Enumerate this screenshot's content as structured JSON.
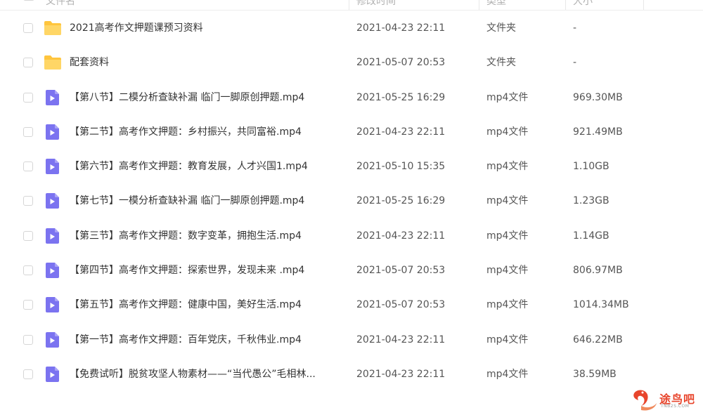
{
  "header": {
    "col_name": "文件名",
    "col_modified": "修改时间",
    "col_type": "类型",
    "col_size": "大小"
  },
  "colors": {
    "folder": "#FFC53D",
    "video": "#7B73F0",
    "text": "#333333",
    "muted": "#555555",
    "watermark": "#E8452C"
  },
  "files": [
    {
      "icon": "folder-icon",
      "name": "2021高考作文押题课预习资料",
      "modified": "2021-04-23 22:11",
      "type": "文件夹",
      "size": "-"
    },
    {
      "icon": "folder-icon",
      "name": "配套资料",
      "modified": "2021-05-07 20:53",
      "type": "文件夹",
      "size": "-"
    },
    {
      "icon": "video-file-icon",
      "name": "【第八节】二模分析查缺补漏 临门一脚原创押题.mp4",
      "modified": "2021-05-25 16:29",
      "type": "mp4文件",
      "size": "969.30MB"
    },
    {
      "icon": "video-file-icon",
      "name": "【第二节】高考作文押题：乡村振兴，共同富裕.mp4",
      "modified": "2021-04-23 22:11",
      "type": "mp4文件",
      "size": "921.49MB"
    },
    {
      "icon": "video-file-icon",
      "name": "【第六节】高考作文押题：教育发展，人才兴国1.mp4",
      "modified": "2021-05-10 15:35",
      "type": "mp4文件",
      "size": "1.10GB"
    },
    {
      "icon": "video-file-icon",
      "name": "【第七节】一模分析查缺补漏 临门一脚原创押题.mp4",
      "modified": "2021-05-25 16:29",
      "type": "mp4文件",
      "size": "1.23GB"
    },
    {
      "icon": "video-file-icon",
      "name": "【第三节】高考作文押题：数字变革，拥抱生活.mp4",
      "modified": "2021-04-23 22:11",
      "type": "mp4文件",
      "size": "1.14GB"
    },
    {
      "icon": "video-file-icon",
      "name": "【第四节】高考作文押题：探索世界，发现未来 .mp4",
      "modified": "2021-05-07 20:53",
      "type": "mp4文件",
      "size": "806.97MB"
    },
    {
      "icon": "video-file-icon",
      "name": "【第五节】高考作文押题：健康中国，美好生活.mp4",
      "modified": "2021-05-07 20:53",
      "type": "mp4文件",
      "size": "1014.34MB"
    },
    {
      "icon": "video-file-icon",
      "name": "【第一节】高考作文押题：百年党庆，千秋伟业.mp4",
      "modified": "2021-04-23 22:11",
      "type": "mp4文件",
      "size": "646.22MB"
    },
    {
      "icon": "video-file-icon",
      "name": "【免费试听】脱贫攻坚人物素材——“当代愚公”毛相林...",
      "modified": "2021-04-23 22:11",
      "type": "mp4文件",
      "size": "38.59MB"
    }
  ],
  "watermark": {
    "title": "途鸟吧",
    "sub": "TNB2S.COM"
  }
}
